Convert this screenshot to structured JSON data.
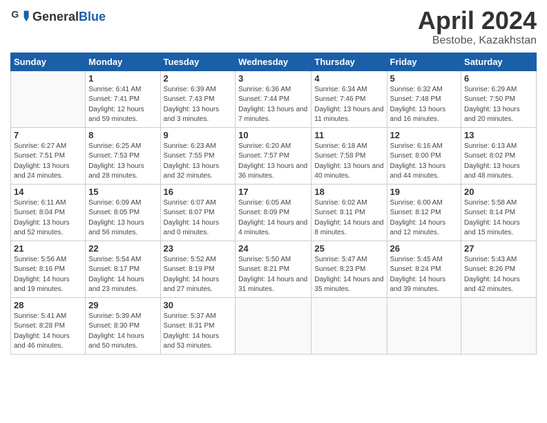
{
  "logo": {
    "general": "General",
    "blue": "Blue"
  },
  "title": "April 2024",
  "subtitle": "Bestobe, Kazakhstan",
  "weekdays": [
    "Sunday",
    "Monday",
    "Tuesday",
    "Wednesday",
    "Thursday",
    "Friday",
    "Saturday"
  ],
  "weeks": [
    [
      null,
      {
        "day": "1",
        "sunrise": "6:41 AM",
        "sunset": "7:41 PM",
        "daylight": "12 hours and 59 minutes."
      },
      {
        "day": "2",
        "sunrise": "6:39 AM",
        "sunset": "7:43 PM",
        "daylight": "13 hours and 3 minutes."
      },
      {
        "day": "3",
        "sunrise": "6:36 AM",
        "sunset": "7:44 PM",
        "daylight": "13 hours and 7 minutes."
      },
      {
        "day": "4",
        "sunrise": "6:34 AM",
        "sunset": "7:46 PM",
        "daylight": "13 hours and 11 minutes."
      },
      {
        "day": "5",
        "sunrise": "6:32 AM",
        "sunset": "7:48 PM",
        "daylight": "13 hours and 16 minutes."
      },
      {
        "day": "6",
        "sunrise": "6:29 AM",
        "sunset": "7:50 PM",
        "daylight": "13 hours and 20 minutes."
      }
    ],
    [
      {
        "day": "7",
        "sunrise": "6:27 AM",
        "sunset": "7:51 PM",
        "daylight": "13 hours and 24 minutes."
      },
      {
        "day": "8",
        "sunrise": "6:25 AM",
        "sunset": "7:53 PM",
        "daylight": "13 hours and 28 minutes."
      },
      {
        "day": "9",
        "sunrise": "6:23 AM",
        "sunset": "7:55 PM",
        "daylight": "13 hours and 32 minutes."
      },
      {
        "day": "10",
        "sunrise": "6:20 AM",
        "sunset": "7:57 PM",
        "daylight": "13 hours and 36 minutes."
      },
      {
        "day": "11",
        "sunrise": "6:18 AM",
        "sunset": "7:58 PM",
        "daylight": "13 hours and 40 minutes."
      },
      {
        "day": "12",
        "sunrise": "6:16 AM",
        "sunset": "8:00 PM",
        "daylight": "13 hours and 44 minutes."
      },
      {
        "day": "13",
        "sunrise": "6:13 AM",
        "sunset": "8:02 PM",
        "daylight": "13 hours and 48 minutes."
      }
    ],
    [
      {
        "day": "14",
        "sunrise": "6:11 AM",
        "sunset": "8:04 PM",
        "daylight": "13 hours and 52 minutes."
      },
      {
        "day": "15",
        "sunrise": "6:09 AM",
        "sunset": "8:05 PM",
        "daylight": "13 hours and 56 minutes."
      },
      {
        "day": "16",
        "sunrise": "6:07 AM",
        "sunset": "8:07 PM",
        "daylight": "14 hours and 0 minutes."
      },
      {
        "day": "17",
        "sunrise": "6:05 AM",
        "sunset": "8:09 PM",
        "daylight": "14 hours and 4 minutes."
      },
      {
        "day": "18",
        "sunrise": "6:02 AM",
        "sunset": "8:11 PM",
        "daylight": "14 hours and 8 minutes."
      },
      {
        "day": "19",
        "sunrise": "6:00 AM",
        "sunset": "8:12 PM",
        "daylight": "14 hours and 12 minutes."
      },
      {
        "day": "20",
        "sunrise": "5:58 AM",
        "sunset": "8:14 PM",
        "daylight": "14 hours and 15 minutes."
      }
    ],
    [
      {
        "day": "21",
        "sunrise": "5:56 AM",
        "sunset": "8:16 PM",
        "daylight": "14 hours and 19 minutes."
      },
      {
        "day": "22",
        "sunrise": "5:54 AM",
        "sunset": "8:17 PM",
        "daylight": "14 hours and 23 minutes."
      },
      {
        "day": "23",
        "sunrise": "5:52 AM",
        "sunset": "8:19 PM",
        "daylight": "14 hours and 27 minutes."
      },
      {
        "day": "24",
        "sunrise": "5:50 AM",
        "sunset": "8:21 PM",
        "daylight": "14 hours and 31 minutes."
      },
      {
        "day": "25",
        "sunrise": "5:47 AM",
        "sunset": "8:23 PM",
        "daylight": "14 hours and 35 minutes."
      },
      {
        "day": "26",
        "sunrise": "5:45 AM",
        "sunset": "8:24 PM",
        "daylight": "14 hours and 39 minutes."
      },
      {
        "day": "27",
        "sunrise": "5:43 AM",
        "sunset": "8:26 PM",
        "daylight": "14 hours and 42 minutes."
      }
    ],
    [
      {
        "day": "28",
        "sunrise": "5:41 AM",
        "sunset": "8:28 PM",
        "daylight": "14 hours and 46 minutes."
      },
      {
        "day": "29",
        "sunrise": "5:39 AM",
        "sunset": "8:30 PM",
        "daylight": "14 hours and 50 minutes."
      },
      {
        "day": "30",
        "sunrise": "5:37 AM",
        "sunset": "8:31 PM",
        "daylight": "14 hours and 53 minutes."
      },
      null,
      null,
      null,
      null
    ]
  ]
}
